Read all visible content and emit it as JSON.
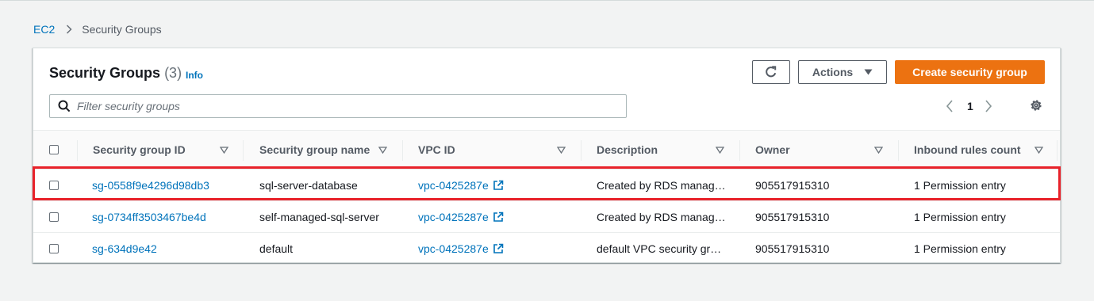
{
  "breadcrumb": {
    "root": "EC2",
    "current": "Security Groups"
  },
  "header": {
    "title": "Security Groups",
    "count": "(3)",
    "info": "Info"
  },
  "toolbar": {
    "actions_label": "Actions",
    "create_label": "Create security group"
  },
  "search": {
    "placeholder": "Filter security groups",
    "value": ""
  },
  "pagination": {
    "current_page": "1"
  },
  "table": {
    "columns": [
      "Security group ID",
      "Security group name",
      "VPC ID",
      "Description",
      "Owner",
      "Inbound rules count"
    ],
    "rows": [
      {
        "id": "sg-0558f9e4296d98db3",
        "name": "sql-server-database",
        "vpc": "vpc-0425287e",
        "description": "Created by RDS manag…",
        "owner": "905517915310",
        "inbound": "1 Permission entry"
      },
      {
        "id": "sg-0734ff3503467be4d",
        "name": "self-managed-sql-server",
        "vpc": "vpc-0425287e",
        "description": "Created by RDS manag…",
        "owner": "905517915310",
        "inbound": "1 Permission entry"
      },
      {
        "id": "sg-634d9e42",
        "name": "default",
        "vpc": "vpc-0425287e",
        "description": "default VPC security gr…",
        "owner": "905517915310",
        "inbound": "1 Permission entry"
      }
    ]
  },
  "colors": {
    "link": "#0073bb",
    "primary": "#ec7211",
    "highlight": "#e8222a"
  },
  "icons": [
    "chevron-right-icon",
    "refresh-icon",
    "caret-down-icon",
    "search-icon",
    "chevron-left-icon",
    "settings-icon",
    "sort-icon",
    "external-link-icon"
  ]
}
